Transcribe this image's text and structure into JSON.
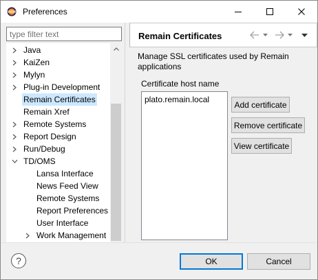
{
  "window": {
    "title": "Preferences",
    "app_icon": "eclipse-icon",
    "controls": [
      "minimize-icon",
      "maximize-icon",
      "close-icon"
    ]
  },
  "filter": {
    "placeholder": "type filter text",
    "value": ""
  },
  "tree": {
    "items": [
      {
        "label": "Java",
        "expandable": true,
        "expanded": false,
        "level": 0,
        "selected": false
      },
      {
        "label": "KaiZen",
        "expandable": true,
        "expanded": false,
        "level": 0,
        "selected": false
      },
      {
        "label": "Mylyn",
        "expandable": true,
        "expanded": false,
        "level": 0,
        "selected": false
      },
      {
        "label": "Plug-in Development",
        "expandable": true,
        "expanded": false,
        "level": 0,
        "selected": false
      },
      {
        "label": "Remain Certificates",
        "expandable": false,
        "expanded": false,
        "level": 0,
        "selected": true
      },
      {
        "label": "Remain Xref",
        "expandable": false,
        "expanded": false,
        "level": 0,
        "selected": false
      },
      {
        "label": "Remote Systems",
        "expandable": true,
        "expanded": false,
        "level": 0,
        "selected": false
      },
      {
        "label": "Report Design",
        "expandable": true,
        "expanded": false,
        "level": 0,
        "selected": false
      },
      {
        "label": "Run/Debug",
        "expandable": true,
        "expanded": false,
        "level": 0,
        "selected": false
      },
      {
        "label": "TD/OMS",
        "expandable": true,
        "expanded": true,
        "level": 0,
        "selected": false
      },
      {
        "label": "Lansa Interface",
        "expandable": false,
        "expanded": false,
        "level": 1,
        "selected": false
      },
      {
        "label": "News Feed View",
        "expandable": false,
        "expanded": false,
        "level": 1,
        "selected": false
      },
      {
        "label": "Remote Systems",
        "expandable": false,
        "expanded": false,
        "level": 1,
        "selected": false
      },
      {
        "label": "Report Preferences",
        "expandable": false,
        "expanded": false,
        "level": 1,
        "selected": false
      },
      {
        "label": "User Interface",
        "expandable": false,
        "expanded": false,
        "level": 1,
        "selected": false
      },
      {
        "label": "Work Management",
        "expandable": true,
        "expanded": false,
        "level": 1,
        "selected": false
      }
    ]
  },
  "page": {
    "title": "Remain Certificates",
    "header_icons": [
      "back-arrow-icon",
      "back-menu-icon",
      "forward-arrow-icon",
      "forward-menu-icon",
      "view-menu-icon"
    ],
    "description": "Manage SSL certificates used by Remain applications",
    "group_label": "Certificate host name",
    "hosts": [
      "plato.remain.local"
    ],
    "buttons": {
      "add": "Add certificate",
      "remove": "Remove certificate",
      "view": "View certificate"
    }
  },
  "footer": {
    "help_icon": "help-icon",
    "ok_label": "OK",
    "cancel_label": "Cancel"
  },
  "colors": {
    "selection": "#cce8ff",
    "default_button_border": "#0078d7",
    "window_background": "#f0f0f0"
  }
}
